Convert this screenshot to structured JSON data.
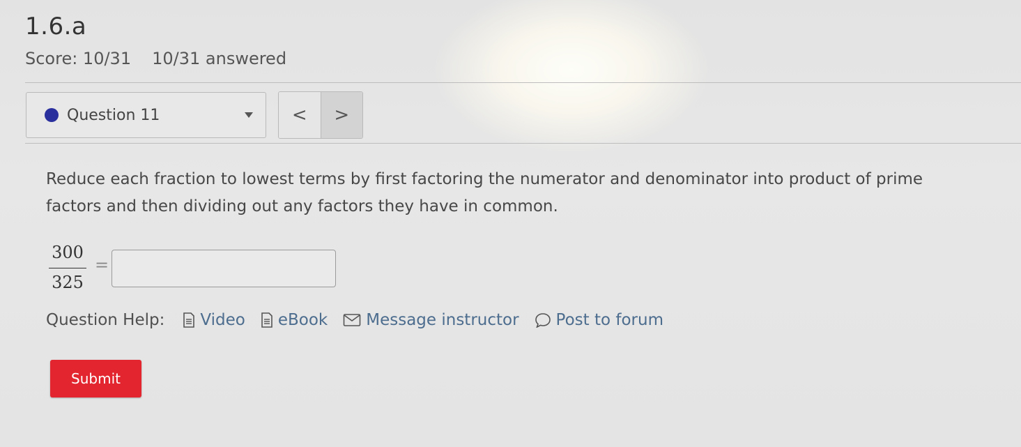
{
  "header": {
    "title": "1.6.a",
    "score": "Score: 10/31",
    "answered": "10/31 answered"
  },
  "navigator": {
    "question_label": "Question 11",
    "prev_symbol": "<",
    "next_symbol": ">",
    "status_dot_color": "#2a2f9e"
  },
  "question": {
    "prompt": "Reduce each fraction to lowest terms by first factoring the numerator and denominator into product of prime factors and then dividing out any factors they have in common.",
    "numerator": "300",
    "denominator": "325",
    "equals": "=",
    "answer_value": ""
  },
  "help": {
    "label": "Question Help:",
    "links": [
      {
        "label": "Video",
        "icon": "document-icon"
      },
      {
        "label": "eBook",
        "icon": "document-icon"
      },
      {
        "label": "Message instructor",
        "icon": "envelope-icon"
      },
      {
        "label": "Post to forum",
        "icon": "speech-bubble-icon"
      }
    ]
  },
  "actions": {
    "submit_label": "Submit",
    "submit_color": "#e2252e"
  }
}
